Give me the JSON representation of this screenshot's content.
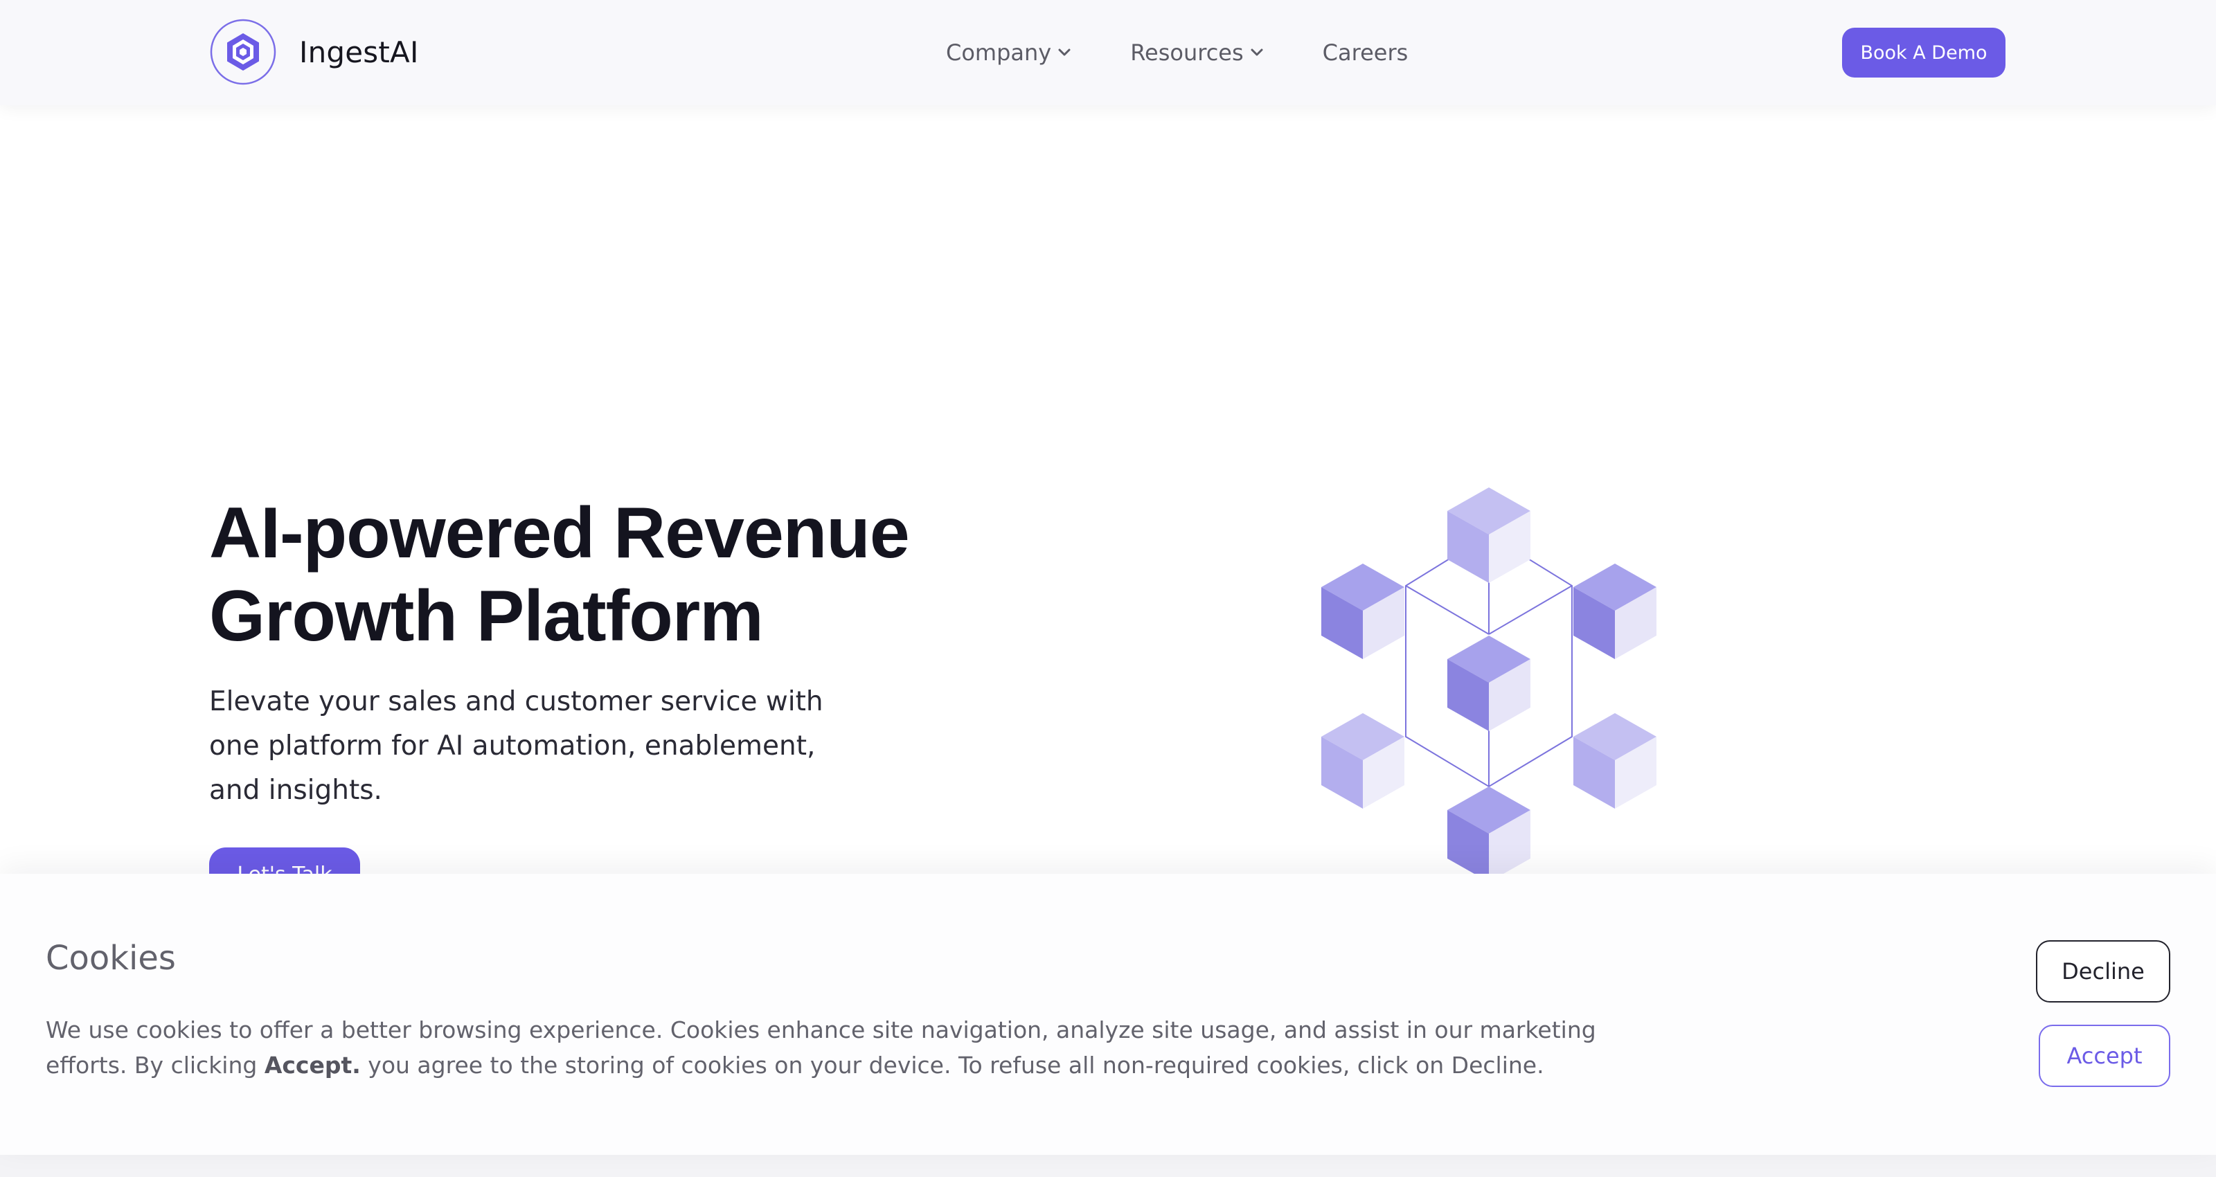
{
  "header": {
    "brand": "IngestAI",
    "nav": [
      {
        "label": "Company",
        "has_dropdown": true
      },
      {
        "label": "Resources",
        "has_dropdown": true
      },
      {
        "label": "Careers",
        "has_dropdown": false
      }
    ],
    "cta_label": "Book A Demo"
  },
  "hero": {
    "title_line1": "AI-powered Revenue",
    "title_line2": "Growth Platform",
    "subtitle": "Elevate your sales and customer service with one platform for AI automation, enablement, and insights.",
    "cta_label": "Let's Talk"
  },
  "cookies": {
    "title": "Cookies",
    "text_before": "We use cookies to offer a better browsing experience. Cookies enhance site navigation, analyze site usage, and assist in our marketing efforts. By clicking ",
    "text_bold": "Accept.",
    "text_after": " you agree to the storing of cookies on your device. To refuse all non-required cookies, click on Decline.",
    "decline_label": "Decline",
    "accept_label": "Accept"
  },
  "colors": {
    "accent": "#6b5be6",
    "header_bg": "#f8f8fb",
    "heading": "#14141f",
    "muted_text": "#62626c"
  },
  "icons": {
    "logo": "hexagon-logo-icon",
    "dropdown": "chevron-down-icon",
    "hero_art": "cube-network-illustration"
  }
}
